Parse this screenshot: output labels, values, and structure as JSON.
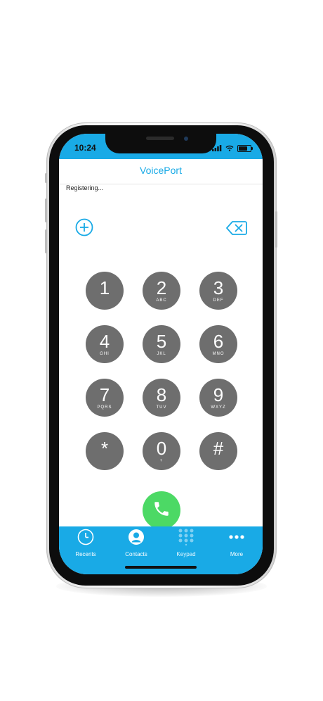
{
  "status_bar": {
    "time": "10:24"
  },
  "app": {
    "title": "VoicePort",
    "registration_status": "Registering..."
  },
  "dialer": {
    "add_icon": "plus-circle-icon",
    "delete_icon": "backspace-icon",
    "keys": [
      {
        "digit": "1",
        "letters": ""
      },
      {
        "digit": "2",
        "letters": "ABC"
      },
      {
        "digit": "3",
        "letters": "DEF"
      },
      {
        "digit": "4",
        "letters": "GHI"
      },
      {
        "digit": "5",
        "letters": "JKL"
      },
      {
        "digit": "6",
        "letters": "MNO"
      },
      {
        "digit": "7",
        "letters": "PQRS"
      },
      {
        "digit": "8",
        "letters": "TUV"
      },
      {
        "digit": "9",
        "letters": "WXYZ"
      },
      {
        "digit": "*",
        "letters": ""
      },
      {
        "digit": "0",
        "letters": "+"
      },
      {
        "digit": "#",
        "letters": ""
      }
    ],
    "call_icon": "phone-icon"
  },
  "tabs": [
    {
      "label": "Recents",
      "icon": "clock-icon"
    },
    {
      "label": "Contacts",
      "icon": "person-icon"
    },
    {
      "label": "Keypad",
      "icon": "keypad-icon"
    },
    {
      "label": "More",
      "icon": "ellipsis-icon"
    }
  ],
  "colors": {
    "accent": "#19aae6",
    "key": "#6e6e6e",
    "call": "#4cd965"
  }
}
